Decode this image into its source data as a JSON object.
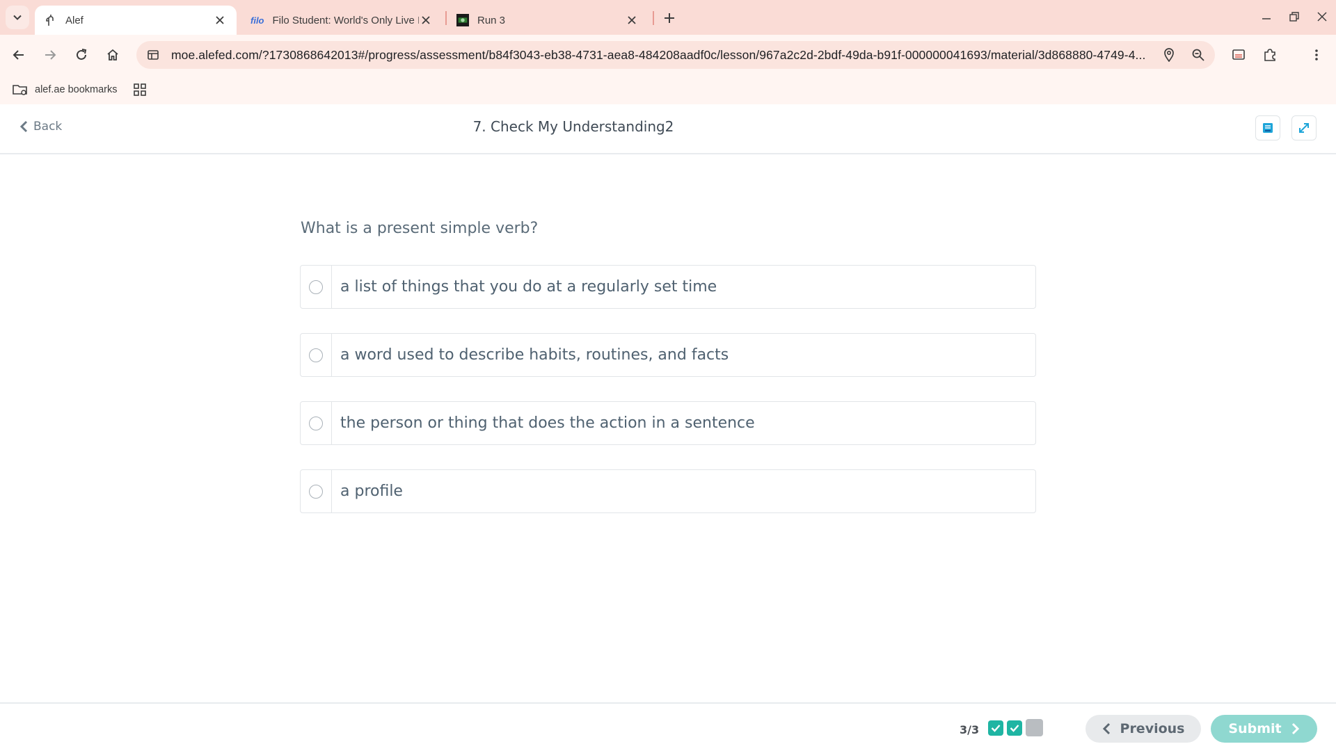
{
  "browser": {
    "tabs": [
      {
        "title": "Alef",
        "favicon": "alef-icon",
        "active": true
      },
      {
        "title": "Filo Student: World's Only Live I",
        "favicon_text": "filo",
        "active": false
      },
      {
        "title": "Run 3",
        "favicon": "run3-game-icon",
        "active": false
      }
    ],
    "url": "moe.alefed.com/?1730868642013#/progress/assessment/b84f3043-eb38-4731-aea8-484208aadf0c/lesson/967a2c2d-2bdf-49da-b91f-000000041693/material/3d868880-4749-4...",
    "bookmarks": [
      {
        "label": "alef.ae bookmarks"
      }
    ]
  },
  "header": {
    "back_label": "Back",
    "title": "7. Check My Understanding2"
  },
  "question": {
    "text": "What is a present simple verb?",
    "options": [
      {
        "text": "a list of things that you do at a regularly set time",
        "selected": false
      },
      {
        "text": "a word used to describe habits, routines, and facts",
        "selected": false
      },
      {
        "text": "the person or thing that does the action in a sentence",
        "selected": false
      },
      {
        "text": "a profile",
        "selected": false
      }
    ]
  },
  "footer": {
    "progress": "3/3",
    "steps": [
      "done",
      "done",
      "todo"
    ],
    "previous_label": "Previous",
    "submit_label": "Submit"
  },
  "colors": {
    "tabstrip": "#fadcd6",
    "accent_teal": "#1fb5a3",
    "submit_disabled": "#8fd8d0",
    "text_muted": "#5a6b78"
  }
}
